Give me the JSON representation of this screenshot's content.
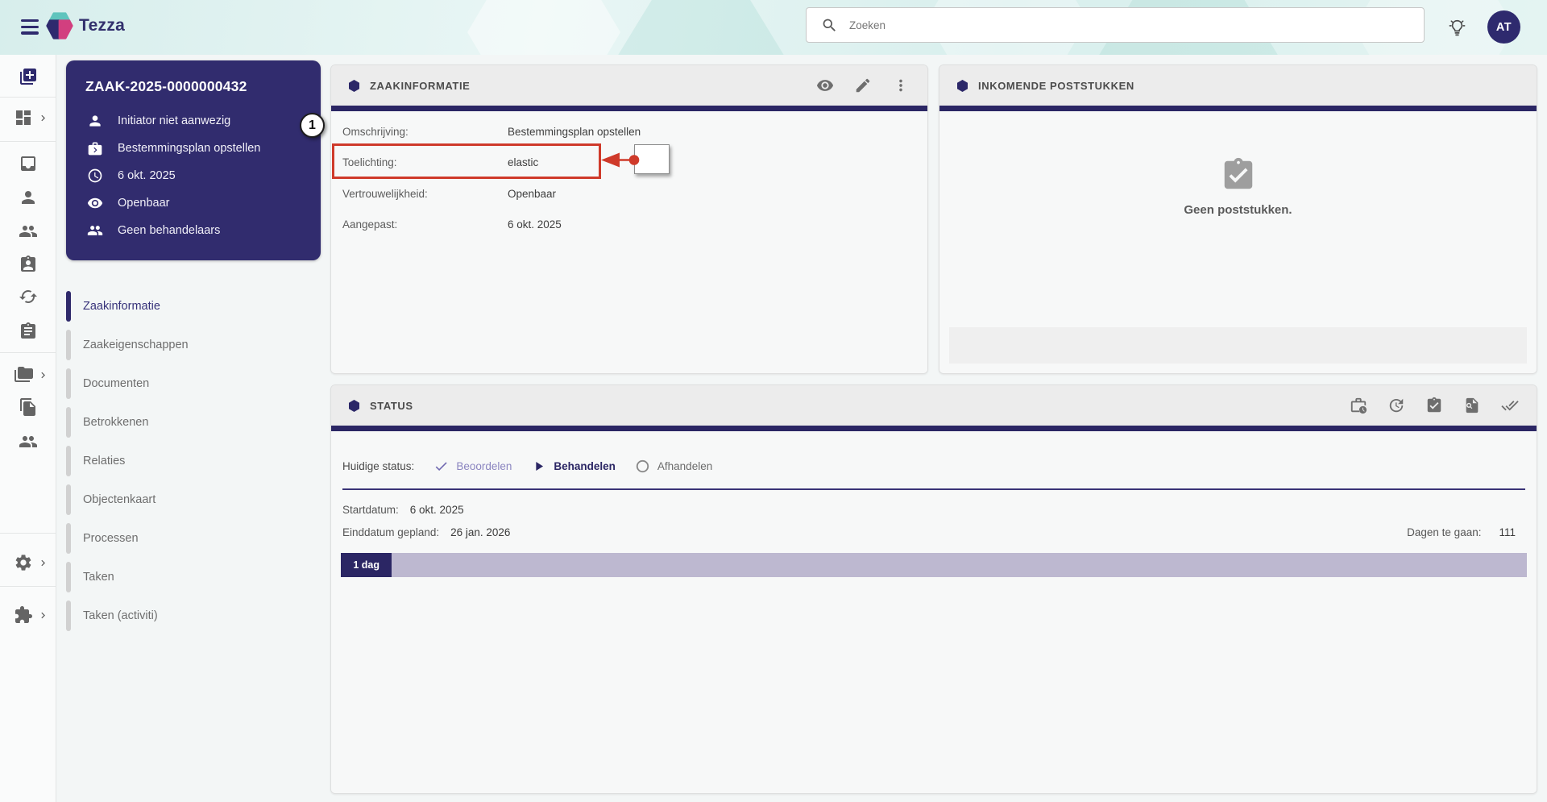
{
  "topbar": {
    "brand": "Tezza",
    "search_placeholder": "Zoeken",
    "avatar_initials": "AT"
  },
  "rail": {
    "icons": [
      "library-add",
      "dashboard",
      "inbox",
      "person",
      "people",
      "assignment-person",
      "sync",
      "clipboard",
      "folders",
      "documents",
      "group",
      "settings",
      "extension"
    ]
  },
  "case_card": {
    "case_id": "ZAAK-2025-0000000432",
    "rows": [
      {
        "icon": "person-icon",
        "text": "Initiator niet aanwezig"
      },
      {
        "icon": "briefcase-icon",
        "text": "Bestemmingsplan opstellen"
      },
      {
        "icon": "clock-icon",
        "text": "6 okt. 2025"
      },
      {
        "icon": "eye-icon",
        "text": "Openbaar"
      },
      {
        "icon": "people-icon",
        "text": "Geen behandelaars"
      }
    ]
  },
  "annotation": {
    "badge_label": "1"
  },
  "nav": {
    "items": [
      {
        "label": "Zaakinformatie",
        "active": true
      },
      {
        "label": "Zaakeigenschappen",
        "active": false
      },
      {
        "label": "Documenten",
        "active": false
      },
      {
        "label": "Betrokkenen",
        "active": false
      },
      {
        "label": "Relaties",
        "active": false
      },
      {
        "label": "Objectenkaart",
        "active": false
      },
      {
        "label": "Processen",
        "active": false
      },
      {
        "label": "Taken",
        "active": false
      },
      {
        "label": "Taken (activiti)",
        "active": false
      }
    ]
  },
  "zaakinformatie": {
    "title": "ZAAKINFORMATIE",
    "fields": [
      {
        "label": "Omschrijving:",
        "value": "Bestemmingsplan opstellen"
      },
      {
        "label": "Toelichting:",
        "value": "elastic"
      },
      {
        "label": "Vertrouwelijkheid:",
        "value": "Openbaar"
      },
      {
        "label": "Aangepast:",
        "value": "6 okt. 2025"
      }
    ]
  },
  "poststukken": {
    "title": "INKOMENDE POSTSTUKKEN",
    "empty_message": "Geen poststukken."
  },
  "status": {
    "title": "STATUS",
    "huidige_label": "Huidige status:",
    "steps": [
      {
        "label": "Beoordelen",
        "state": "done"
      },
      {
        "label": "Behandelen",
        "state": "current"
      },
      {
        "label": "Afhandelen",
        "state": "todo"
      }
    ],
    "startdatum_label": "Startdatum:",
    "startdatum": "6 okt. 2025",
    "einddatum_label": "Einddatum gepland:",
    "einddatum": "26 jan. 2026",
    "dagen_label": "Dagen te gaan:",
    "dagen": "111",
    "progress": {
      "label": "1 dag",
      "pct": 4.3
    }
  },
  "colors": {
    "indigo": "#2b2664",
    "card_indigo": "#312c6e",
    "teal": "#5fc4bd",
    "pink": "#d23f7f",
    "annotation_red": "#cf3a2a",
    "lavender": "#bdb8d0"
  }
}
